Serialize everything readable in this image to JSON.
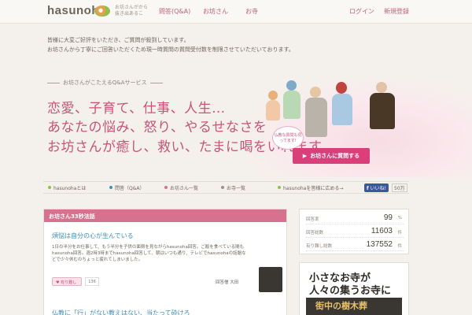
{
  "header": {
    "logo": "hasunoha",
    "logo_sub": "お坊さんがから抜き出あるこ",
    "nav": [
      "問答(Q&A)",
      "お坊さん",
      "お寺"
    ],
    "login": "ログイン",
    "register": "新規登録"
  },
  "notice": {
    "line1": "皆様に大変ご好評をいただき、ご質問が殺到しています。",
    "line2": "お坊さんから丁寧にご回答いただくため現一時質問の質問受付数を制限させていただいております。"
  },
  "hero": {
    "service_title": "お坊さんがこたえるQ&Aサービス",
    "tagline1": "恋愛、子育て、仕事、人生…",
    "tagline2": "あなたの悩み、怒り、やるせなさを",
    "tagline3": "お坊さんが癒し、救い、たまに喝をいれます。",
    "bubble": "仏教な質問も伺ってます!",
    "ask_button": "お坊さんに質問する"
  },
  "subnav": {
    "about": "hasunohaとは",
    "qa": "問答（Q&A）",
    "monks": "お坊さん一覧",
    "temples": "お寺一覧",
    "share": "hasunohaを皆様に広める→",
    "like": "いいね!",
    "like_count": "50万"
  },
  "panel": {
    "title": "お坊さん33秒法話",
    "q1_title": "煩悩は自分の心が生んでいる",
    "q1_body": "1日の半分をお仕事して、もう半分を子供の面倒を見ながらhasunoha回答。ご飯を食べている間もhasunoha回答。週2時3時までhasunoha回答して、朝はいつも通り、テレビでhasunohaの話題などで少々休むのちょっと疲れてしまいました。",
    "like_label": "有り難し",
    "like_count": "136",
    "answerer": "回答僧 大田",
    "q2_title": "仏教に「行」がない教えはない、当たって砕けろ"
  },
  "stats": [
    {
      "label": "回答率",
      "value": "99",
      "unit": "%"
    },
    {
      "label": "回答総数",
      "value": "11603",
      "unit": "件"
    },
    {
      "label": "有り難し総数",
      "value": "137552",
      "unit": "件"
    }
  ],
  "banner": {
    "line1": "小さなお寺が",
    "line2": "人々の集うお寺に",
    "line3": "街中の樹木葬"
  },
  "colors": {
    "accent": "#d9407a",
    "tagline": "#c9537a",
    "link": "#3f8fb8",
    "panel_head": "#d6728f"
  }
}
